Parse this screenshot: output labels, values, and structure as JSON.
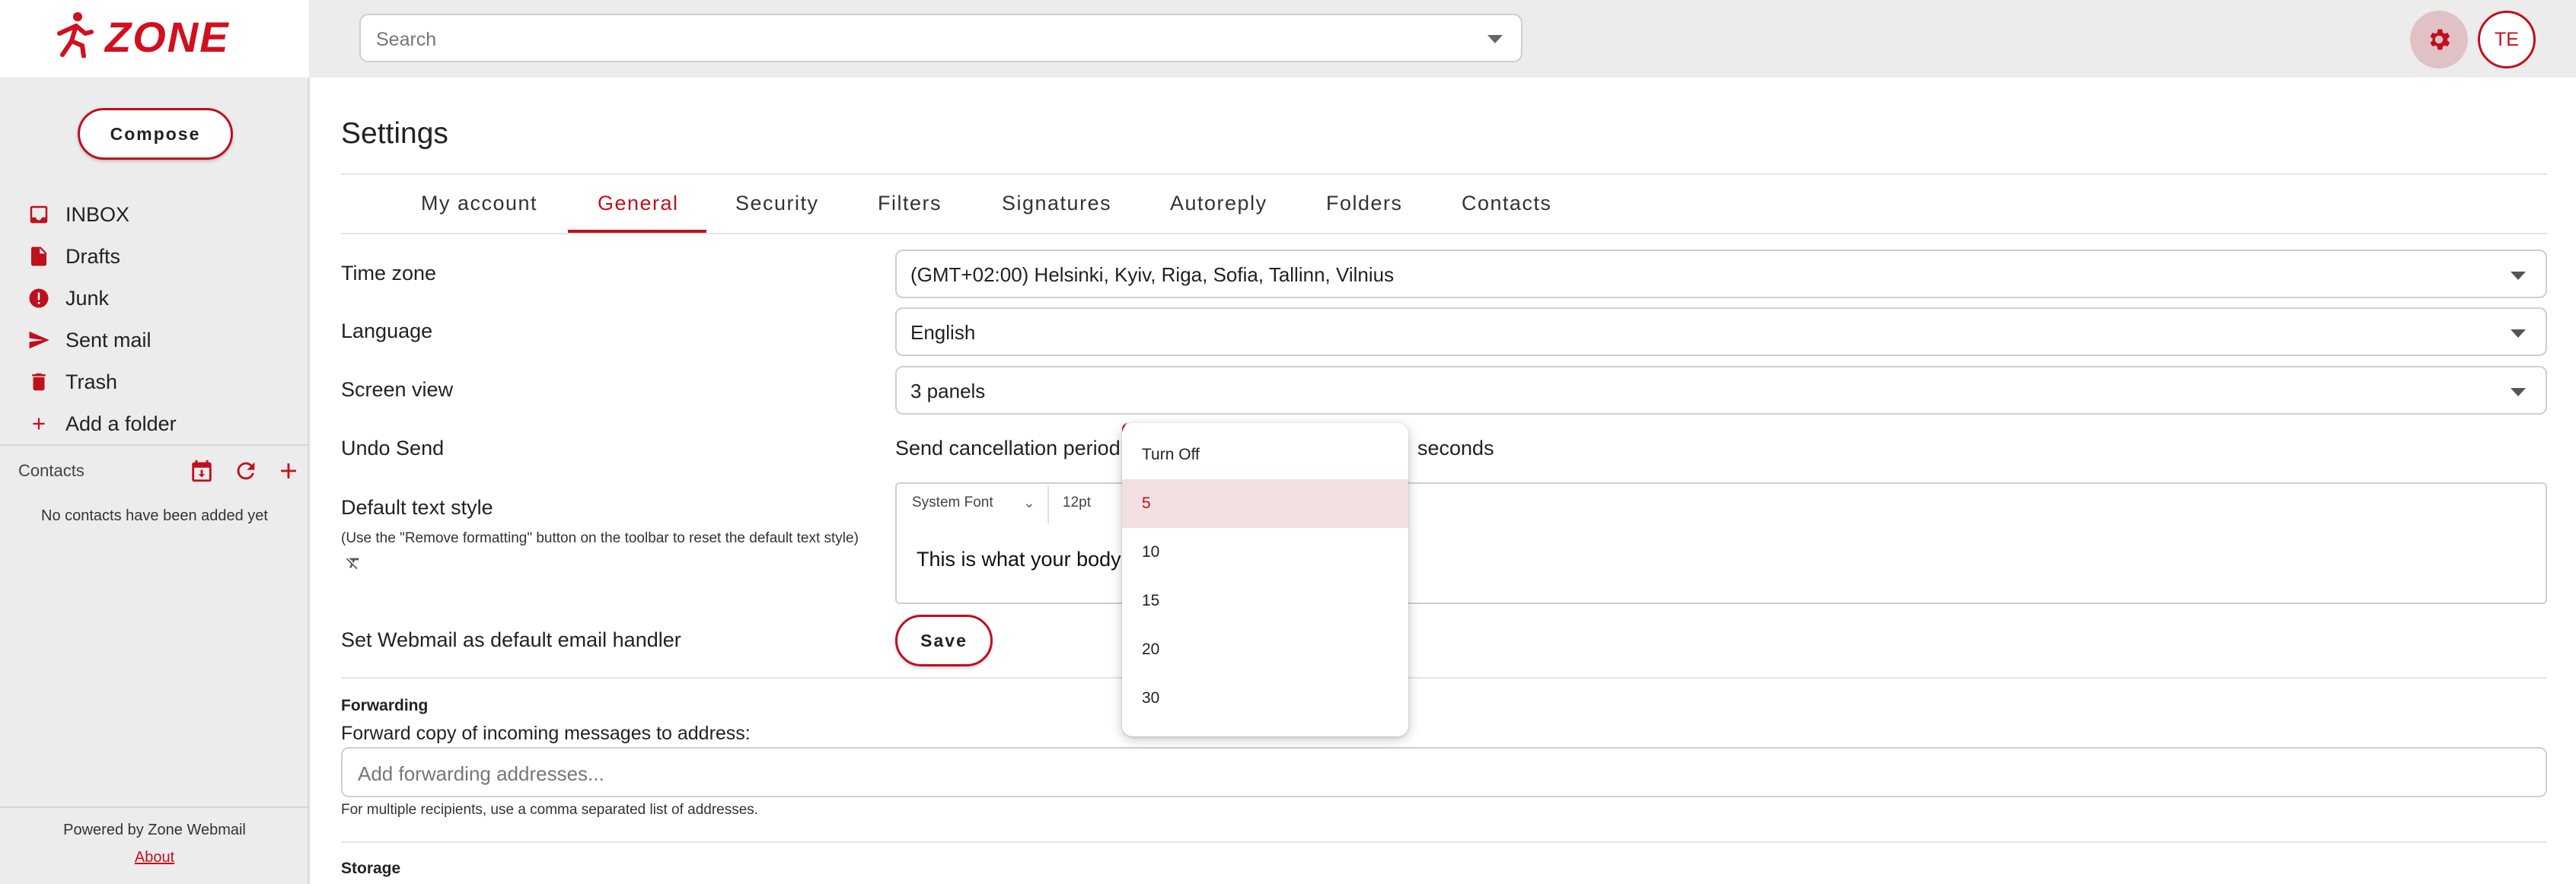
{
  "brand": {
    "name": "ZONE",
    "accent": "#c0101d"
  },
  "header": {
    "search_placeholder": "Search",
    "settings_icon": "gear-icon",
    "avatar_initials": "TE"
  },
  "sidebar": {
    "compose_label": "Compose",
    "folders": [
      {
        "label": "INBOX",
        "icon": "inbox-icon"
      },
      {
        "label": "Drafts",
        "icon": "draft-icon"
      },
      {
        "label": "Junk",
        "icon": "alert-icon"
      },
      {
        "label": "Sent mail",
        "icon": "send-icon"
      },
      {
        "label": "Trash",
        "icon": "trash-icon"
      },
      {
        "label": "Add a folder",
        "icon": "plus-icon"
      }
    ],
    "contacts_label": "Contacts",
    "no_contacts": "No contacts have been added yet",
    "powered_by": "Powered by Zone Webmail",
    "about_link": "About"
  },
  "settings": {
    "title": "Settings",
    "tabs": [
      "My account",
      "General",
      "Security",
      "Filters",
      "Signatures",
      "Autoreply",
      "Folders",
      "Contacts"
    ],
    "active_tab": "General",
    "timezone": {
      "label": "Time zone",
      "value": "(GMT+02:00) Helsinki, Kyiv, Riga, Sofia, Tallinn, Vilnius"
    },
    "language": {
      "label": "Language",
      "value": "English"
    },
    "screen_view": {
      "label": "Screen view",
      "value": "3 panels"
    },
    "undo_send": {
      "label": "Undo Send",
      "period_label": "Send cancellation period:",
      "unit": "seconds",
      "options": [
        "Turn Off",
        "5",
        "10",
        "15",
        "20",
        "30"
      ],
      "selected": "5"
    },
    "default_text_style": {
      "label": "Default text style",
      "note": "(Use the \"Remove formatting\" button on the toolbar to reset the default text style)",
      "font": "System Font",
      "size": "12pt",
      "preview": "This is what your body t"
    },
    "default_handler": {
      "label": "Set Webmail as default email handler",
      "button": "Save"
    },
    "forwarding": {
      "section": "Forwarding",
      "label": "Forward copy of incoming messages to address:",
      "placeholder": "Add forwarding addresses...",
      "note": "For multiple recipients, use a comma separated list of addresses."
    },
    "storage_section": "Storage"
  }
}
